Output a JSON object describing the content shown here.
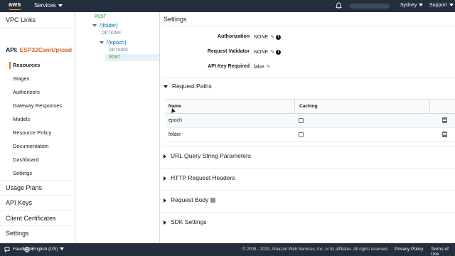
{
  "topbar": {
    "logo_text": "aws",
    "services_label": "Services",
    "region_label": "Sydney",
    "support_label": "Support"
  },
  "leftnav": {
    "vpc_links": "VPC Links",
    "api_prefix": "API:",
    "api_name": "ESP32CamUpload",
    "items": [
      {
        "label": "Resources",
        "active": true
      },
      {
        "label": "Stages"
      },
      {
        "label": "Authorizers"
      },
      {
        "label": "Gateway Responses"
      },
      {
        "label": "Models"
      },
      {
        "label": "Resource Policy"
      },
      {
        "label": "Documentation"
      },
      {
        "label": "Dashboard"
      },
      {
        "label": "Settings"
      }
    ],
    "bottom": [
      "Usage Plans",
      "API Keys",
      "Client Certificates",
      "Settings"
    ]
  },
  "tree": {
    "root_post": "POST",
    "folder": "/{folder}",
    "folder_options": "OPTIONS",
    "epoch": "/{epoch}",
    "epoch_options": "OPTIONS",
    "epoch_post": "POST"
  },
  "settings": {
    "title": "Settings",
    "authorization_label": "Authorization",
    "authorization_value": "NONE",
    "validator_label": "Request Validator",
    "validator_value": "NONE",
    "apikey_label": "API Key Required",
    "apikey_value": "false"
  },
  "request_paths": {
    "title": "Request Paths",
    "columns": [
      "Name",
      "Caching"
    ],
    "rows": [
      {
        "name": "epoch",
        "caching": false
      },
      {
        "name": "folder",
        "caching": false
      }
    ]
  },
  "sections": {
    "url_query": "URL Query String Parameters",
    "http_headers": "HTTP Request Headers",
    "request_body": "Request Body",
    "sdk_settings": "SDK Settings"
  },
  "footer": {
    "feedback": "Feedback",
    "language": "English (US)",
    "copyright": "© 2008 - 2020, Amazon Web Services, Inc. or its affiliates. All rights reserved.",
    "privacy": "Privacy Policy",
    "terms": "Terms of Use"
  },
  "colors": {
    "header_bg": "#232f3e",
    "accent_orange": "#ec7211",
    "api_name": "#d4682b",
    "link_blue": "#0073bb",
    "post_green": "#1d8102"
  }
}
